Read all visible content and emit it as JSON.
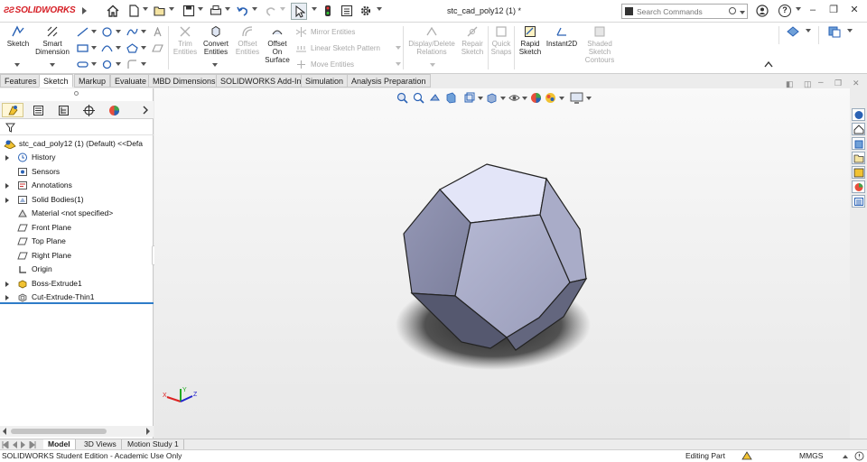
{
  "app": {
    "brand": "SOLIDWORKS",
    "document_title": "stc_cad_poly12 (1) *"
  },
  "search": {
    "placeholder": "Search Commands"
  },
  "commands": {
    "sketch": "Sketch",
    "smart_dimension": [
      "Smart",
      "Dimension"
    ],
    "trim_entities": [
      "Trim",
      "Entities"
    ],
    "convert_entities": [
      "Convert",
      "Entities"
    ],
    "offset_entities": [
      "Offset",
      "Entities"
    ],
    "offset_on_surface": [
      "Offset",
      "On",
      "Surface"
    ],
    "mirror_entities": "Mirror Entities",
    "linear_sketch_pattern": "Linear Sketch Pattern",
    "move_entities": "Move Entities",
    "display_delete_relations": [
      "Display/Delete",
      "Relations"
    ],
    "repair_sketch": [
      "Repair",
      "Sketch"
    ],
    "quick_snaps": [
      "Quick",
      "Snaps"
    ],
    "rapid_sketch": [
      "Rapid",
      "Sketch"
    ],
    "instant2d": "Instant2D",
    "shaded_sketch_contours": [
      "Shaded",
      "Sketch",
      "Contours"
    ]
  },
  "tabs": [
    "Features",
    "Sketch",
    "Markup",
    "Evaluate",
    "MBD Dimensions",
    "SOLIDWORKS Add-Ins",
    "Simulation",
    "Analysis Preparation"
  ],
  "active_tab": "Sketch",
  "feature_tree": {
    "root": "stc_cad_poly12 (1) (Default) <<Defa",
    "items": [
      {
        "label": "History",
        "expandable": true,
        "icon": "history-icon"
      },
      {
        "label": "Sensors",
        "expandable": false,
        "icon": "sensors-icon"
      },
      {
        "label": "Annotations",
        "expandable": true,
        "icon": "annotations-icon"
      },
      {
        "label": "Solid Bodies(1)",
        "expandable": true,
        "icon": "solid-bodies-icon"
      },
      {
        "label": "Material <not specified>",
        "expandable": false,
        "icon": "material-icon"
      },
      {
        "label": "Front Plane",
        "expandable": false,
        "icon": "plane-icon"
      },
      {
        "label": "Top Plane",
        "expandable": false,
        "icon": "plane-icon"
      },
      {
        "label": "Right Plane",
        "expandable": false,
        "icon": "plane-icon"
      },
      {
        "label": "Origin",
        "expandable": false,
        "icon": "origin-icon"
      },
      {
        "label": "Boss-Extrude1",
        "expandable": true,
        "icon": "boss-extrude-icon"
      },
      {
        "label": "Cut-Extrude-Thin1",
        "expandable": true,
        "icon": "cut-extrude-icon"
      }
    ]
  },
  "triad": {
    "x": "X",
    "y": "Y",
    "z": "Z"
  },
  "bottom_tabs": [
    "Model",
    "3D Views",
    "Motion Study 1"
  ],
  "status": {
    "edition": "SOLIDWORKS Student Edition - Academic Use Only",
    "mode": "Editing Part",
    "units": "MMGS"
  },
  "colors": {
    "brand_red": "#d61f26",
    "part_face_light": "#e6e8fb",
    "part_face_mid": "#a7aac6",
    "part_face_dark": "#50536a",
    "selection_blue": "#2e7cc8"
  }
}
